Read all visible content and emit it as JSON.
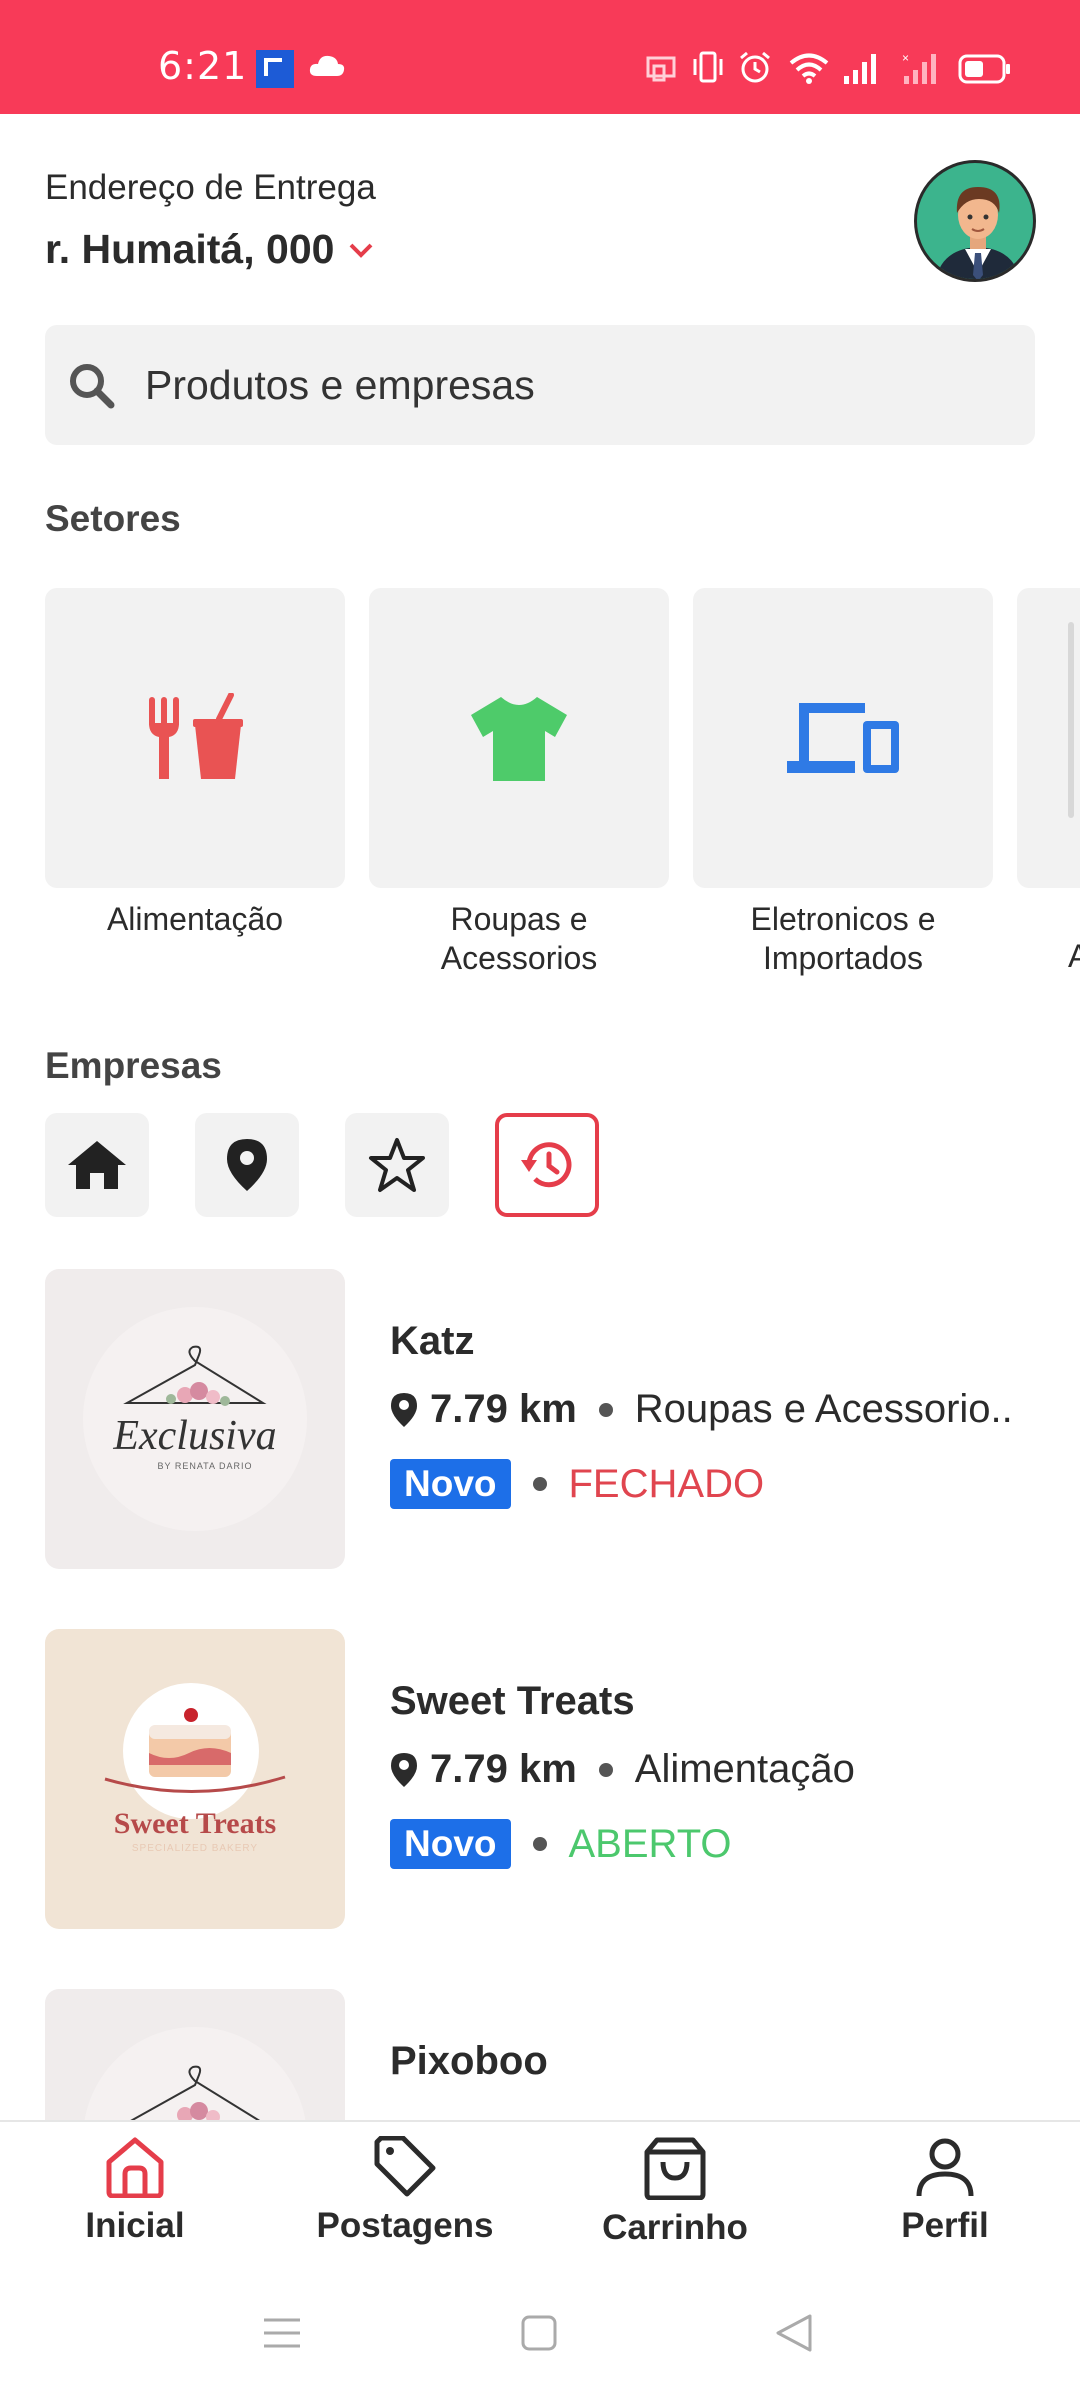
{
  "status": {
    "time": "6:21"
  },
  "header": {
    "address_label": "Endereço de Entrega",
    "address_value": "r. Humaitá, 000"
  },
  "search": {
    "placeholder": "Produtos e empresas"
  },
  "sectors": {
    "title": "Setores",
    "items": [
      {
        "label": "Alimentação",
        "icon": "food-drink-icon",
        "color": "#e95353"
      },
      {
        "label": "Roupas e Acessorios",
        "icon": "tshirt-icon",
        "color": "#4ecb6a"
      },
      {
        "label": "Eletronicos e Importados",
        "icon": "devices-icon",
        "color": "#2f7ae5"
      }
    ],
    "partial_char": "A"
  },
  "companies": {
    "title": "Empresas",
    "filters": [
      "home-icon",
      "location-pin-icon",
      "star-icon",
      "history-icon"
    ],
    "items": [
      {
        "name": "Katz",
        "distance": "7.79 km",
        "category": "Roupas e Acessorio..",
        "badge": "Novo",
        "status": "FECHADO",
        "logo_text": "Exclusiva",
        "logo_sub": "BY RENATA DARIO"
      },
      {
        "name": "Sweet Treats",
        "distance": "7.79 km",
        "category": "Alimentação",
        "badge": "Novo",
        "status": "ABERTO",
        "logo_text": "Sweet Treats",
        "logo_sub": "SPECIALIZED BAKERY"
      },
      {
        "name": "Pixoboo"
      }
    ]
  },
  "bottom_nav": {
    "items": [
      {
        "label": "Inicial",
        "icon": "home-outline-icon"
      },
      {
        "label": "Postagens",
        "icon": "tag-icon"
      },
      {
        "label": "Carrinho",
        "icon": "shopping-bag-icon"
      },
      {
        "label": "Perfil",
        "icon": "user-icon"
      }
    ]
  },
  "colors": {
    "accent": "#f83a58",
    "badge": "#1d6fe8",
    "closed": "#e0454f",
    "open": "#4cc86d"
  }
}
